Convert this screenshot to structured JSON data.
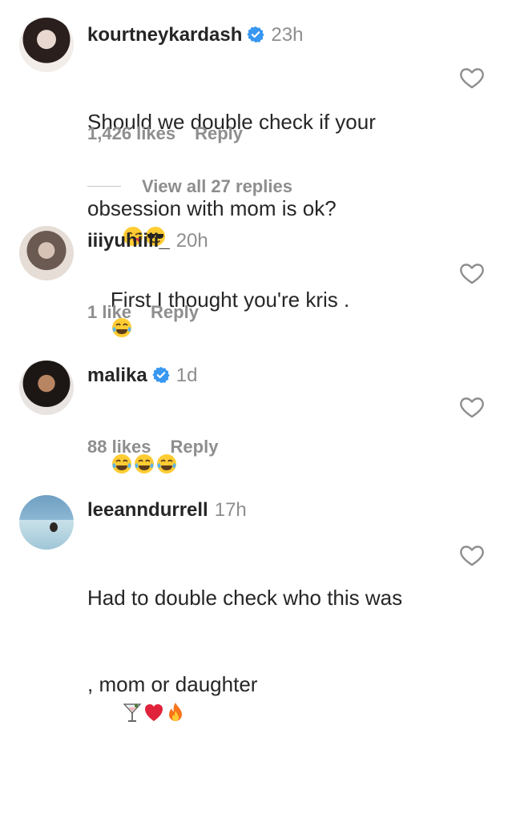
{
  "comments": [
    {
      "username": "kourtneykardash",
      "verified": true,
      "time": "23h",
      "text_line1": "Should we double check if your",
      "text_line2": "obsession with mom is ok?",
      "emojis": [
        "kissing-face-emoji",
        "sunglasses-face-emoji"
      ],
      "likes": "1,426 likes",
      "reply": "Reply",
      "view_replies": "View all 27 replies"
    },
    {
      "username": "iiiyuhiiii_",
      "verified": false,
      "time": "20h",
      "text_line1": "First I thought you're kris .",
      "emojis": [
        "tears-of-joy-emoji"
      ],
      "likes": "1 like",
      "reply": "Reply"
    },
    {
      "username": "malika",
      "verified": true,
      "time": "1d",
      "text_line1": "",
      "emojis": [
        "tears-of-joy-emoji",
        "tears-of-joy-emoji",
        "tears-of-joy-emoji"
      ],
      "likes": "88 likes",
      "reply": "Reply"
    },
    {
      "username": "leeanndurrell",
      "verified": false,
      "time": "17h",
      "text_line1": "Had to double check who this was",
      "text_line2": ", mom or daughter",
      "emojis": [
        "cocktail-emoji",
        "red-heart-emoji",
        "fire-emoji"
      ]
    }
  ],
  "colors": {
    "text": "#262626",
    "secondary": "#8e8e8e",
    "verified": "#3897f0"
  }
}
